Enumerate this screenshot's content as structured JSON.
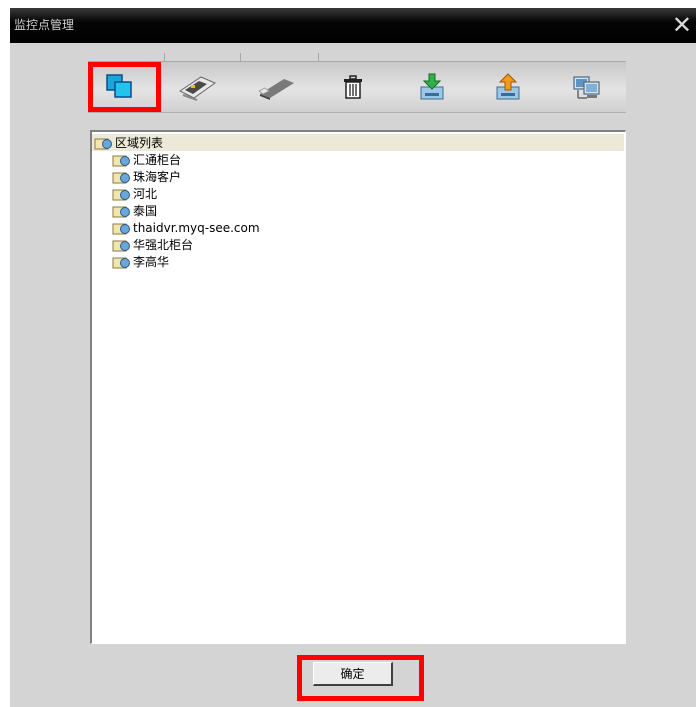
{
  "window": {
    "title": "监控点管理"
  },
  "toolbar": {
    "items": [
      {
        "name": "add-area",
        "icon": "copy-squares-icon",
        "highlighted": true
      },
      {
        "name": "add-device",
        "icon": "circuit-board-icon"
      },
      {
        "name": "device-module",
        "icon": "usb-stick-icon"
      },
      {
        "name": "delete",
        "icon": "trash-icon"
      },
      {
        "name": "import",
        "icon": "import-down-arrow-icon"
      },
      {
        "name": "export",
        "icon": "export-up-arrow-icon"
      },
      {
        "name": "network-devices",
        "icon": "network-computers-icon"
      }
    ]
  },
  "tree": {
    "root_label": "区域列表",
    "items": [
      "汇通柜台",
      "珠海客户",
      "河北",
      "泰国",
      "thaidvr.myq-see.com",
      "华强北柜台",
      "李高华"
    ]
  },
  "footer": {
    "ok_label": "确定",
    "ok_highlighted": true
  },
  "colors": {
    "highlight": "#ff0000",
    "titlebar": "#000000",
    "panel": "#d4d4d4"
  }
}
